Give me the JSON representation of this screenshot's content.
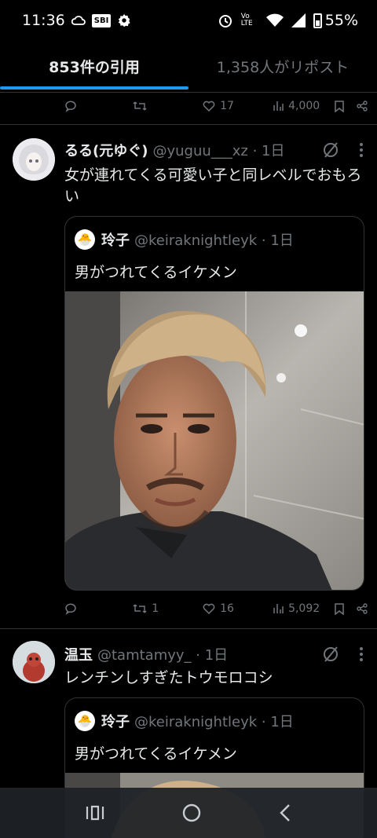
{
  "status": {
    "time": "11:36",
    "sbi": "SBI",
    "volte": "Vo LTE",
    "battery": "55%"
  },
  "tabs": [
    {
      "label": "853件の引用",
      "active": true
    },
    {
      "label": "1,358人がリポスト",
      "active": false
    }
  ],
  "prev_actions": {
    "retweets": "",
    "likes": "17",
    "views": "4,000"
  },
  "tweets": [
    {
      "name": "るる(元ゆぐ)",
      "handle": "@yuguu___xz",
      "time": "1日",
      "text": "女が連れてくる可愛い子と同レベルでおもろい",
      "quote": {
        "name": "玲子",
        "handle": "@keiraknightleyk",
        "time": "1日",
        "text": "男がつれてくるイケメン"
      },
      "actions": {
        "retweets": "1",
        "likes": "16",
        "views": "5,092"
      }
    },
    {
      "name": "温玉",
      "handle": "@tamtamyy_",
      "time": "1日",
      "text": "レンチンしすぎたトウモロコシ",
      "quote": {
        "name": "玲子",
        "handle": "@keiraknightleyk",
        "time": "1日",
        "text": "男がつれてくるイケメン"
      }
    }
  ],
  "colors": {
    "accent": "#1d9bf0",
    "muted": "#71767b",
    "border": "#2f3336"
  }
}
